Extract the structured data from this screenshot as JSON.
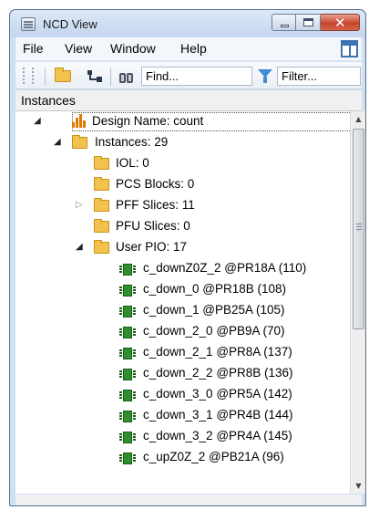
{
  "window": {
    "title": "NCD View",
    "close_glyph": "✕"
  },
  "menu": {
    "items": [
      "File",
      "View",
      "Window",
      "Help"
    ]
  },
  "toolbar": {
    "find_value": "Find...",
    "filter_value": "Filter..."
  },
  "panel": {
    "title": "Instances"
  },
  "tree": {
    "design": "Design Name: count",
    "instances": "Instances: 29",
    "iol": "IOL: 0",
    "pcs": "PCS Blocks: 0",
    "pff": "PFF Slices: 11",
    "pfu": "PFU Slices: 0",
    "user_pio": "User PIO: 17",
    "pio_items": [
      "c_downZ0Z_2 @PR18A (110)",
      "c_down_0 @PR18B (108)",
      "c_down_1 @PB25A (105)",
      "c_down_2_0 @PB9A (70)",
      "c_down_2_1 @PR8A (137)",
      "c_down_2_2 @PR8B (136)",
      "c_down_3_0 @PR5A (142)",
      "c_down_3_1 @PR4B (144)",
      "c_down_3_2 @PR4A (145)",
      "c_upZ0Z_2 @PB21A (96)"
    ]
  },
  "glyphs": {
    "expanded": "◢",
    "collapsed": "▷",
    "scroll_up": "▲",
    "scroll_down": "▼"
  },
  "icons": {
    "app": "ncd-view-app-icon",
    "folder": "folder-icon",
    "design": "design-hierarchy-icon",
    "chip": "pio-chip-icon",
    "filter": "filter-funnel-icon",
    "find": "binoculars-icon"
  },
  "colors": {
    "folder": "#f2c14e",
    "chip": "#2f8f2f",
    "close_button": "#c6462d",
    "title_bar": "#c3d6ee"
  }
}
